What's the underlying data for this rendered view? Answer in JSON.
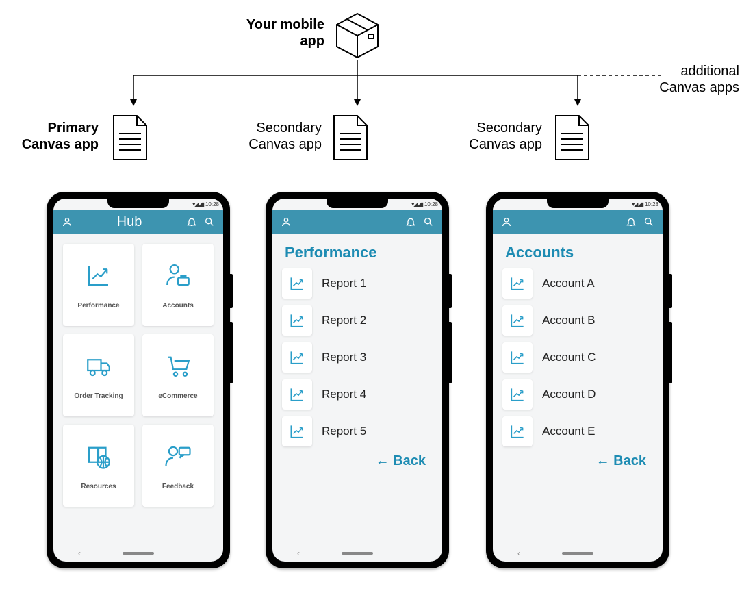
{
  "top": {
    "label": "Your mobile\napp"
  },
  "side": {
    "label": "additional\nCanvas apps"
  },
  "docs": [
    {
      "label": "Primary\nCanvas app",
      "bold": true
    },
    {
      "label": "Secondary\nCanvas app",
      "bold": false
    },
    {
      "label": "Secondary\nCanvas app",
      "bold": false
    }
  ],
  "phone1": {
    "status_time": "10:28",
    "header_title": "Hub",
    "tiles": [
      {
        "label": "Performance",
        "icon": "chart"
      },
      {
        "label": "Accounts",
        "icon": "person-briefcase"
      },
      {
        "label": "Order Tracking",
        "icon": "truck"
      },
      {
        "label": "eCommerce",
        "icon": "cart"
      },
      {
        "label": "Resources",
        "icon": "book-globe"
      },
      {
        "label": "Feedback",
        "icon": "person-chat"
      }
    ]
  },
  "phone2": {
    "status_time": "10:28",
    "section_title": "Performance",
    "items": [
      "Report 1",
      "Report 2",
      "Report 3",
      "Report 4",
      "Report 5"
    ],
    "back": "← Back"
  },
  "phone3": {
    "status_time": "10:28",
    "section_title": "Accounts",
    "items": [
      "Account A",
      "Account B",
      "Account C",
      "Account D",
      "Account E"
    ],
    "back": "← Back"
  },
  "colors": {
    "accent": "#3d94b0",
    "icon": "#2a9ec9"
  }
}
